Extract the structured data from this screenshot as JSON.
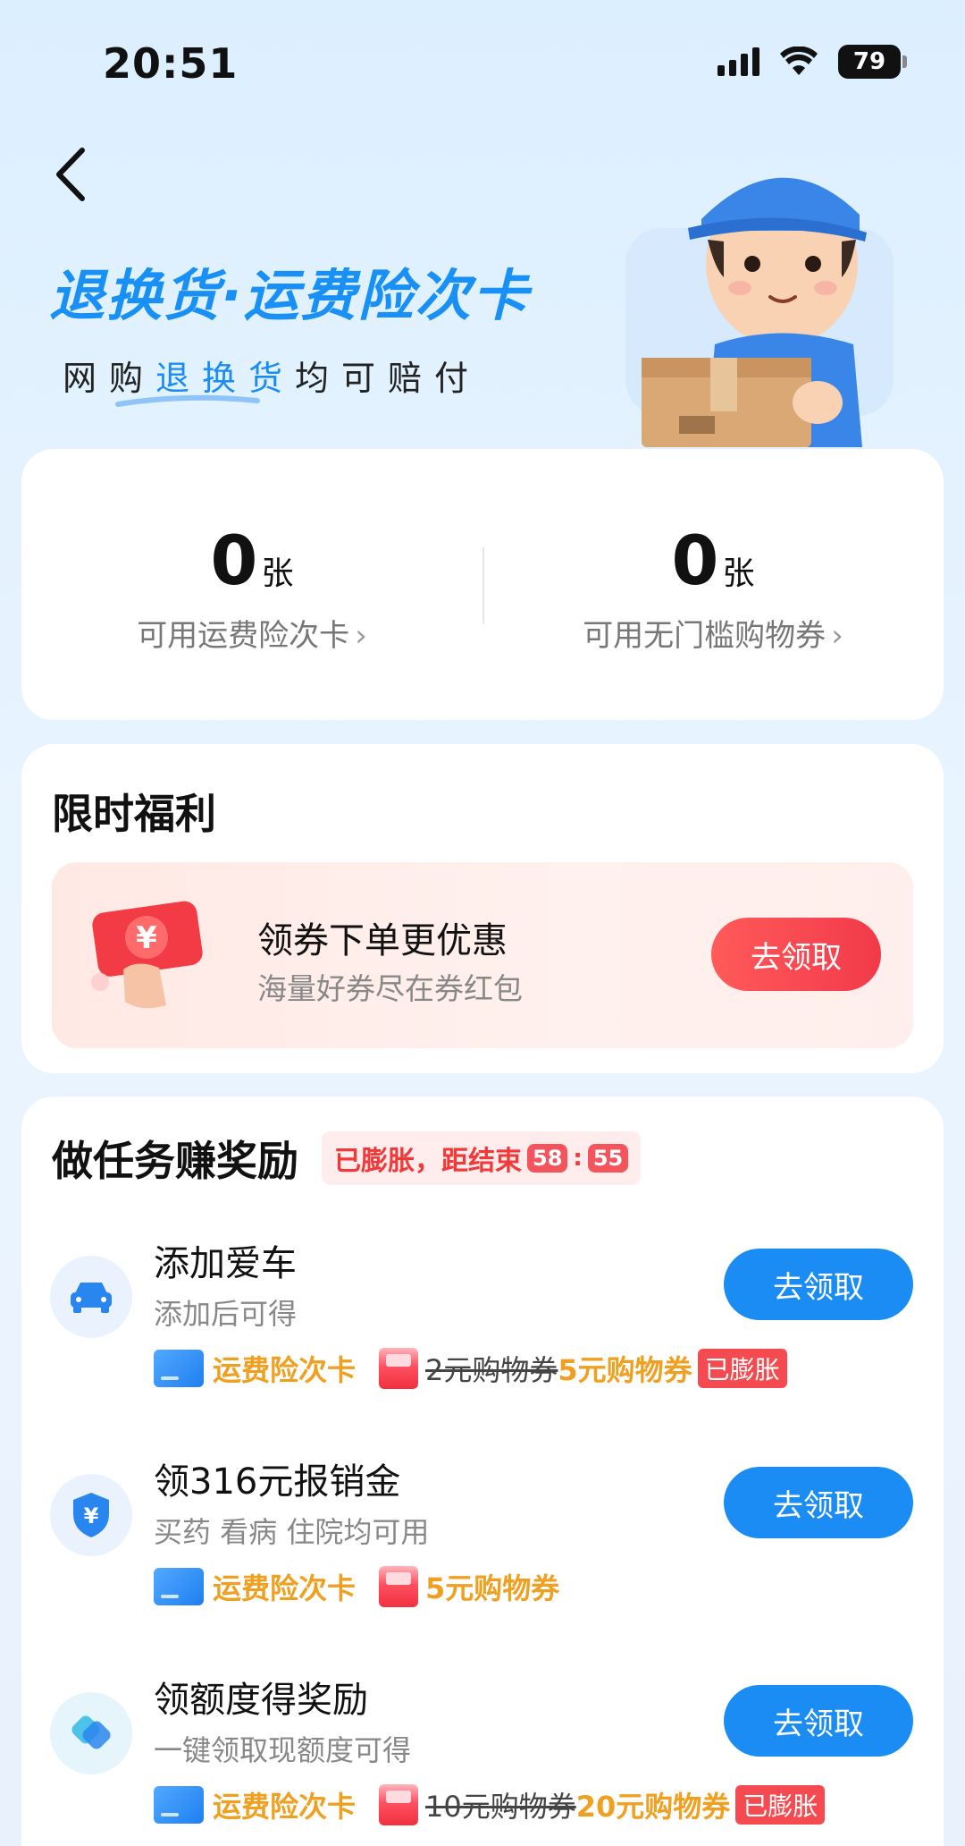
{
  "status_bar": {
    "time": "20:51",
    "battery": "79"
  },
  "header": {
    "title": "退换货·运费险次卡",
    "subtitle_pre": "网购",
    "subtitle_highlight": "退换货",
    "subtitle_post": "均可赔付"
  },
  "stats": [
    {
      "value": "0",
      "unit": "张",
      "label": "可用运费险次卡"
    },
    {
      "value": "0",
      "unit": "张",
      "label": "可用无门槛购物券"
    }
  ],
  "welfare": {
    "title": "限时福利",
    "promo_title": "领券下单更优惠",
    "promo_subtitle": "海量好券尽在券红包",
    "button": "去领取"
  },
  "tasks_section": {
    "title": "做任务赚奖励",
    "badge_text": "已膨胀，距结束",
    "countdown_min": "58",
    "countdown_sec": "55",
    "items": [
      {
        "name": "添加爱车",
        "desc": "添加后可得",
        "reward_card": "运费险次卡",
        "reward_old": "2元购物券",
        "reward_new": "5元购物券",
        "badge": "已膨胀",
        "button": "去领取"
      },
      {
        "name": "领316元报销金",
        "desc": "买药 看病 住院均可用",
        "reward_card": "运费险次卡",
        "reward_new": "5元购物券",
        "button": "去领取"
      },
      {
        "name": "领额度得奖励",
        "desc": "一键领取现额度可得",
        "reward_card": "运费险次卡",
        "reward_old": "10元购物券",
        "reward_new": "20元购物券",
        "badge": "已膨胀",
        "button": "去领取"
      }
    ]
  }
}
